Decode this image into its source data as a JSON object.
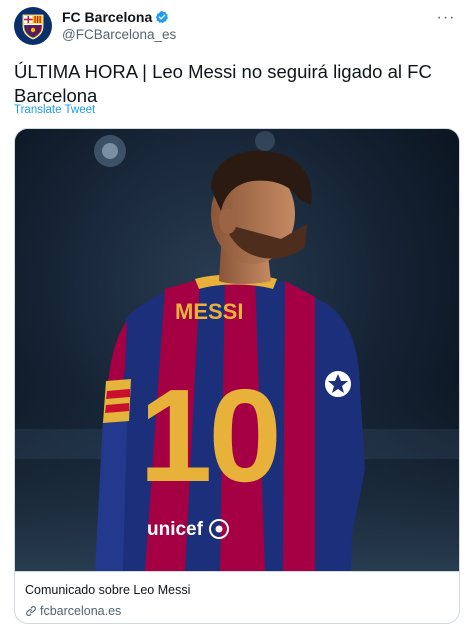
{
  "header": {
    "display_name": "FC Barcelona",
    "handle": "@FCBarcelona_es",
    "more_label": "···",
    "avatar_icon": "fc-barcelona-crest-icon",
    "verified_icon": "verified-badge-icon"
  },
  "tweet": {
    "text": "ÚLTIMA HORA | Leo Messi no seguirá ligado al FC Barcelona",
    "translate_label": "Translate Tweet"
  },
  "card": {
    "jersey_name": "MESSI",
    "jersey_number": "10",
    "sponsor": "unicef",
    "title": "Comunicado sobre Leo Messi",
    "domain": "fcbarcelona.es",
    "link_icon": "link-icon"
  },
  "colors": {
    "accent": "#1d9bf0",
    "text_primary": "#0f1419",
    "text_secondary": "#536471",
    "border": "#cfd9de",
    "barca_blue": "#1b2f7a",
    "barca_red": "#a50044",
    "jersey_gold": "#e8b23a"
  }
}
